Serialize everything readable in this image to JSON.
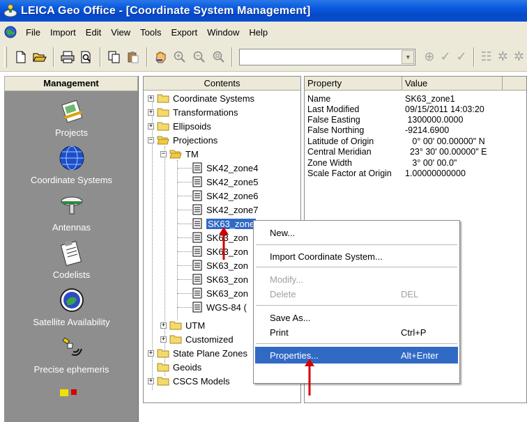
{
  "window": {
    "title": "LEICA Geo Office - [Coordinate System Management]"
  },
  "menu": [
    "File",
    "Import",
    "Edit",
    "View",
    "Tools",
    "Export",
    "Window",
    "Help"
  ],
  "management": {
    "header": "Management",
    "items": [
      {
        "label": "Projects"
      },
      {
        "label": "Coordinate Systems"
      },
      {
        "label": "Antennas"
      },
      {
        "label": "Codelists"
      },
      {
        "label": "Satellite Availability"
      },
      {
        "label": "Precise ephemeris"
      }
    ]
  },
  "contents": {
    "header": "Contents",
    "tree": [
      {
        "label": "Coordinate Systems"
      },
      {
        "label": "Transformations"
      },
      {
        "label": "Ellipsoids"
      },
      {
        "label": "Projections"
      },
      {
        "label": "TM"
      },
      {
        "label": "SK42_zone4"
      },
      {
        "label": "SK42_zone5"
      },
      {
        "label": "SK42_zone6"
      },
      {
        "label": "SK42_zone7"
      },
      {
        "label": "SK63_zone"
      },
      {
        "label": "SK63_zon"
      },
      {
        "label": "SK63_zon"
      },
      {
        "label": "SK63_zon"
      },
      {
        "label": "SK63_zon"
      },
      {
        "label": "SK63_zon"
      },
      {
        "label": "WGS-84 ("
      },
      {
        "label": "UTM"
      },
      {
        "label": "Customized"
      },
      {
        "label": "State Plane Zones"
      },
      {
        "label": "Geoids"
      },
      {
        "label": "CSCS Models"
      }
    ]
  },
  "properties": {
    "col_property": "Property",
    "col_value": "Value",
    "rows": [
      {
        "key": "Name",
        "value": "SK63_zone1"
      },
      {
        "key": "Last Modified",
        "value": "09/15/2011 14:03:20"
      },
      {
        "key": "False Easting",
        "value": " 1300000.0000"
      },
      {
        "key": "False Northing",
        "value": "-9214.6900"
      },
      {
        "key": "Latitude of Origin",
        "value": "   0° 00' 00.00000\" N"
      },
      {
        "key": "Central Meridian",
        "value": "  23° 30' 00.00000\" E"
      },
      {
        "key": "Zone Width",
        "value": "   3° 00' 00.0\""
      },
      {
        "key": "Scale Factor at Origin",
        "value": "1.00000000000"
      }
    ]
  },
  "context_menu": {
    "items": [
      {
        "label": "New...",
        "shortcut": ""
      },
      {
        "label": "Import Coordinate System...",
        "shortcut": ""
      },
      {
        "label": "Modify...",
        "shortcut": ""
      },
      {
        "label": "Delete",
        "shortcut": "DEL"
      },
      {
        "label": "Save As...",
        "shortcut": ""
      },
      {
        "label": "Print",
        "shortcut": "Ctrl+P"
      },
      {
        "label": "Properties...",
        "shortcut": "Alt+Enter"
      }
    ]
  },
  "colors": {
    "selection": "#316ac5",
    "title_bar": "#0a5be0",
    "panel_gray": "#8e8e8e",
    "annotation_arrow": "#d40000"
  }
}
